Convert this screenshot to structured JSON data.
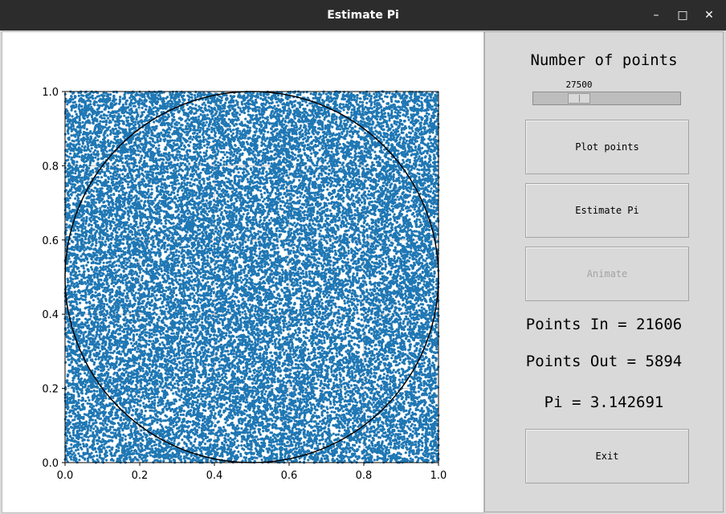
{
  "window": {
    "title": "Estimate Pi",
    "minimize_glyph": "–",
    "maximize_glyph": "□",
    "close_glyph": "✕"
  },
  "panel": {
    "heading": "Number of points",
    "slider_value": "27500",
    "slider_position": 27500,
    "buttons": {
      "plot_points": "Plot points",
      "estimate_pi": "Estimate Pi",
      "animate": "Animate",
      "exit": "Exit"
    },
    "points_in": "Points In = 21606",
    "points_out": "Points Out = 5894",
    "pi_estimate": "Pi = 3.142691"
  },
  "chart_data": {
    "type": "scatter",
    "title": "",
    "xlabel": "",
    "ylabel": "",
    "xlim": [
      0.0,
      1.0
    ],
    "ylim": [
      0.0,
      1.0
    ],
    "grid": true,
    "x_ticks": [
      "0.0",
      "0.2",
      "0.4",
      "0.6",
      "0.8",
      "1.0"
    ],
    "y_ticks": [
      "0.0",
      "0.2",
      "0.4",
      "0.6",
      "0.8",
      "1.0"
    ],
    "num_points": 27500,
    "point_color": "#1f77b4",
    "distribution": "uniform random on unit square",
    "circle": {
      "center": [
        0.5,
        0.5
      ],
      "radius": 0.5,
      "color": "#000000"
    }
  }
}
